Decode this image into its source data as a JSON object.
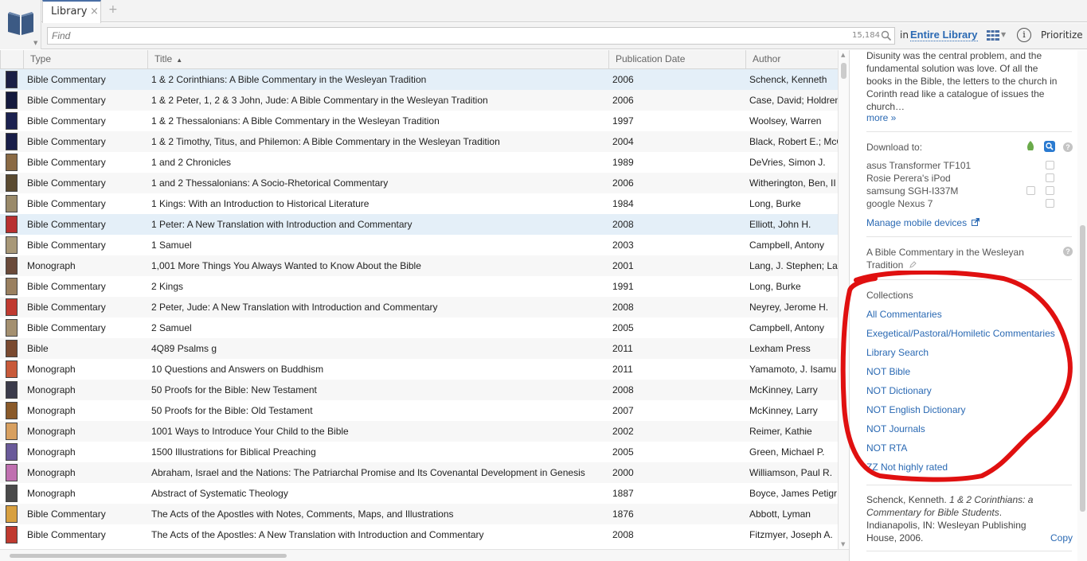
{
  "tabs": {
    "library_label": "Library",
    "close": "×",
    "new": "+"
  },
  "search": {
    "placeholder": "Find",
    "count": "15,184",
    "in_label": "in",
    "scope": "Entire Library",
    "prioritize": "Prioritize",
    "info": "i"
  },
  "table": {
    "columns": {
      "type": "Type",
      "title": "Title",
      "date": "Publication Date",
      "author": "Author"
    },
    "sort_indicator": "▲",
    "rows": [
      {
        "type": "Bible Commentary",
        "title": "1 & 2 Corinthians: A Bible Commentary in the Wesleyan Tradition",
        "date": "2006",
        "author": "Schenck, Kenneth",
        "cover": "#1a1f45"
      },
      {
        "type": "Bible Commentary",
        "title": "1 & 2 Peter, 1, 2 & 3 John, Jude: A Bible Commentary in the Wesleyan Tradition",
        "date": "2006",
        "author": "Case, David; Holdren",
        "cover": "#14193d"
      },
      {
        "type": "Bible Commentary",
        "title": "1 & 2 Thessalonians: A Bible Commentary in the Wesleyan Tradition",
        "date": "1997",
        "author": "Woolsey, Warren",
        "cover": "#1c2250"
      },
      {
        "type": "Bible Commentary",
        "title": "1 & 2 Timothy, Titus, and Philemon: A Bible Commentary in the Wesleyan Tradition",
        "date": "2004",
        "author": "Black, Robert E.; McC",
        "cover": "#181d48"
      },
      {
        "type": "Bible Commentary",
        "title": "1 and 2 Chronicles",
        "date": "1989",
        "author": "DeVries, Simon J.",
        "cover": "#8a6a44"
      },
      {
        "type": "Bible Commentary",
        "title": "1 and 2 Thessalonians: A Socio-Rhetorical Commentary",
        "date": "2006",
        "author": "Witherington, Ben, II",
        "cover": "#5a4a30"
      },
      {
        "type": "Bible Commentary",
        "title": "1 Kings: With an Introduction to Historical Literature",
        "date": "1984",
        "author": "Long, Burke",
        "cover": "#9a8a6a"
      },
      {
        "type": "Bible Commentary",
        "title": "1 Peter: A New Translation with Introduction and Commentary",
        "date": "2008",
        "author": "Elliott, John H.",
        "cover": "#b83030"
      },
      {
        "type": "Bible Commentary",
        "title": "1 Samuel",
        "date": "2003",
        "author": "Campbell, Antony",
        "cover": "#a89878"
      },
      {
        "type": "Monograph",
        "title": "1,001 More Things You Always Wanted to Know About the Bible",
        "date": "2001",
        "author": "Lang, J. Stephen; La",
        "cover": "#6a4a3a"
      },
      {
        "type": "Bible Commentary",
        "title": "2 Kings",
        "date": "1991",
        "author": "Long, Burke",
        "cover": "#9a8060"
      },
      {
        "type": "Bible Commentary",
        "title": "2 Peter, Jude: A New Translation with Introduction and Commentary",
        "date": "2008",
        "author": "Neyrey, Jerome H.",
        "cover": "#c03a30"
      },
      {
        "type": "Bible Commentary",
        "title": "2 Samuel",
        "date": "2005",
        "author": "Campbell, Antony",
        "cover": "#a49070"
      },
      {
        "type": "Bible",
        "title": "4Q89 Psalms g",
        "date": "2011",
        "author": "Lexham Press",
        "cover": "#7a4a30"
      },
      {
        "type": "Monograph",
        "title": "10 Questions and Answers on Buddhism",
        "date": "2011",
        "author": "Yamamoto, J. Isamu",
        "cover": "#c85a3a"
      },
      {
        "type": "Monograph",
        "title": "50 Proofs for the Bible: New Testament",
        "date": "2008",
        "author": "McKinney, Larry",
        "cover": "#3a3a4a"
      },
      {
        "type": "Monograph",
        "title": "50 Proofs for the Bible: Old Testament",
        "date": "2007",
        "author": "McKinney, Larry",
        "cover": "#8a5a2a"
      },
      {
        "type": "Monograph",
        "title": "1001 Ways to Introduce Your Child to the Bible",
        "date": "2002",
        "author": "Reimer, Kathie",
        "cover": "#d8a060"
      },
      {
        "type": "Monograph",
        "title": "1500 Illustrations for Biblical Preaching",
        "date": "2005",
        "author": "Green, Michael P.",
        "cover": "#6a5a9a"
      },
      {
        "type": "Monograph",
        "title": "Abraham, Israel and the Nations: The Patriarchal Promise and Its Covenantal Development in Genesis",
        "date": "2000",
        "author": "Williamson, Paul R.",
        "cover": "#c070b0"
      },
      {
        "type": "Monograph",
        "title": "Abstract of Systematic Theology",
        "date": "1887",
        "author": "Boyce, James Petigr",
        "cover": "#4a4a4a"
      },
      {
        "type": "Bible Commentary",
        "title": "The Acts of the Apostles with Notes, Comments, Maps, and Illustrations",
        "date": "1876",
        "author": "Abbott, Lyman",
        "cover": "#d8a040"
      },
      {
        "type": "Bible Commentary",
        "title": "The Acts of the Apostles: A New Translation with Introduction and Commentary",
        "date": "2008",
        "author": "Fitzmyer, Joseph A.",
        "cover": "#c03a30"
      }
    ]
  },
  "panel": {
    "description": "Disunity was the central problem, and the fundamental solution was love. Of all the books in the Bible, the letters to the church in Corinth read like a catalogue of issues the church…",
    "more": "more »",
    "download_label": "Download to:",
    "devices": [
      "asus Transformer TF101",
      "Rosie Perera's iPod",
      "samsung SGH-I337M",
      "google Nexus 7"
    ],
    "manage": "Manage mobile devices",
    "series": "A Bible Commentary in the Wesleyan Tradition",
    "collections_label": "Collections",
    "collections": [
      "All Commentaries",
      "Exegetical/Pastoral/Homiletic Commentaries",
      "Library Search",
      "NOT Bible",
      "NOT Dictionary",
      "NOT English Dictionary",
      "NOT Journals",
      "NOT RTA",
      "ZZ Not highly rated"
    ],
    "citation": {
      "authors": "Schenck, Kenneth. ",
      "title": "1 & 2 Corinthians: a Commentary for Bible Students",
      "rest": ". Indianapolis, IN: Wesleyan Publishing House, 2006."
    },
    "copy": "Copy",
    "help": "?"
  },
  "colors": {
    "accent": "#2a69b3",
    "selected_row": "#e4eff8",
    "annotation": "#e01010"
  }
}
